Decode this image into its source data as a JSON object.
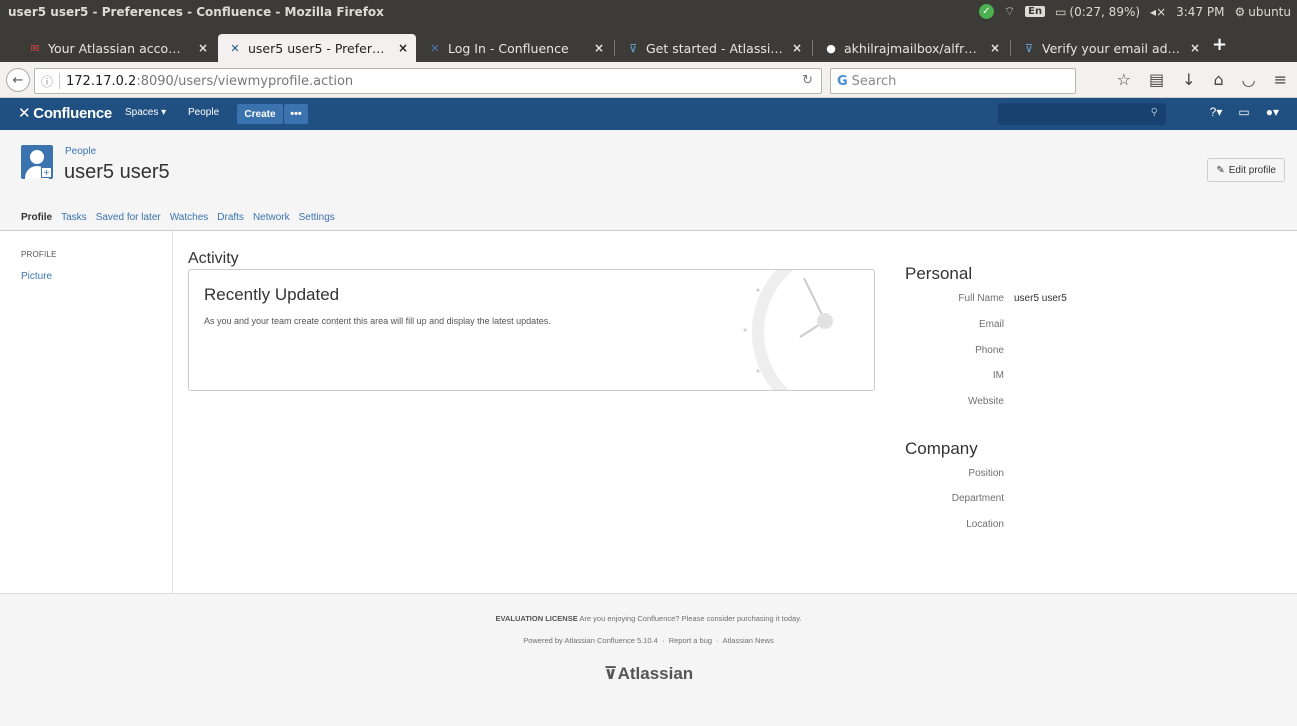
{
  "os": {
    "window_title": "user5 user5 - Preferences - Confluence - Mozilla Firefox",
    "lang": "En",
    "battery": "(0:27, 89%)",
    "time": "3:47 PM",
    "user": "ubuntu"
  },
  "tabs": [
    {
      "label": "Your Atlassian acco…",
      "icon": "gmail-icon"
    },
    {
      "label": "user5 user5 - Prefer…",
      "icon": "confluence-icon"
    },
    {
      "label": "Log In - Confluence",
      "icon": "confluence-icon"
    },
    {
      "label": "Get started - Atlassi…",
      "icon": "atlassian-icon"
    },
    {
      "label": "akhilrajmailbox/alfr…",
      "icon": "github-icon"
    },
    {
      "label": "Verify your email ad…",
      "icon": "atlassian-icon"
    }
  ],
  "nav": {
    "url_host": "172.17.0.2",
    "url_rest": ":8090/users/viewmyprofile.action",
    "search_placeholder": "Search"
  },
  "confluence": {
    "logo": "Confluence",
    "spaces": "Spaces",
    "people": "People",
    "create": "Create",
    "more": "•••"
  },
  "page": {
    "breadcrumb": "People",
    "title": "user5 user5",
    "edit_button": "Edit profile",
    "tabs": [
      "Profile",
      "Tasks",
      "Saved for later",
      "Watches",
      "Drafts",
      "Network",
      "Settings"
    ]
  },
  "sidebar": {
    "heading": "PROFILE",
    "link": "Picture"
  },
  "activity": {
    "heading": "Activity",
    "box_title": "Recently Updated",
    "box_text": "As you and your team create content this area will fill up and display the latest updates."
  },
  "personal": {
    "heading": "Personal",
    "fields": [
      {
        "label": "Full Name",
        "value": "user5 user5"
      },
      {
        "label": "Email",
        "value": ""
      },
      {
        "label": "Phone",
        "value": ""
      },
      {
        "label": "IM",
        "value": ""
      },
      {
        "label": "Website",
        "value": ""
      }
    ]
  },
  "company": {
    "heading": "Company",
    "fields": [
      {
        "label": "Position",
        "value": ""
      },
      {
        "label": "Department",
        "value": ""
      },
      {
        "label": "Location",
        "value": ""
      }
    ]
  },
  "footer": {
    "license_bold": "EVALUATION LICENSE",
    "license_text": "Are you enjoying Confluence? Please consider purchasing it today.",
    "powered": "Powered by Atlassian Confluence 5.10.4",
    "sep": "·",
    "report": "Report a bug",
    "news": "Atlassian News",
    "logo": "Atlassian"
  }
}
